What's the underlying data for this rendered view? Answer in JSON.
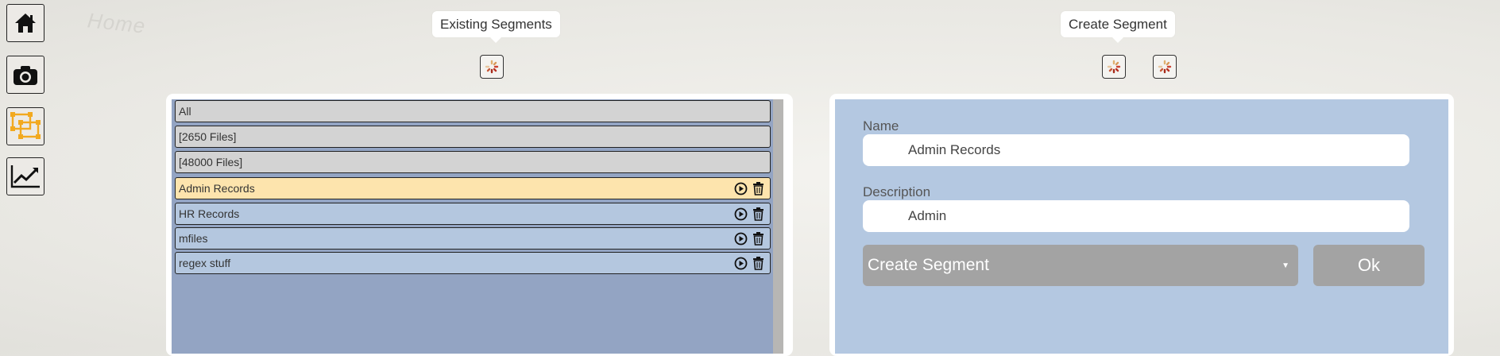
{
  "nav": {
    "ghost_title": "Home",
    "items": [
      {
        "name": "home-icon"
      },
      {
        "name": "camera-icon"
      },
      {
        "name": "segments-icon",
        "accent": "#f2a91f"
      },
      {
        "name": "chart-line-icon"
      }
    ]
  },
  "existing_segments": {
    "tooltip": "Existing Segments",
    "rows": [
      {
        "label": "All",
        "kind": "plain"
      },
      {
        "label": "[2650 Files]",
        "kind": "plain"
      },
      {
        "label": "[48000 Files]",
        "kind": "plain"
      },
      {
        "label": "Admin Records",
        "kind": "selected"
      },
      {
        "label": "HR Records",
        "kind": "item"
      },
      {
        "label": "mfiles",
        "kind": "item"
      },
      {
        "label": "regex stuff",
        "kind": "item"
      }
    ]
  },
  "create_segment": {
    "tooltip": "Create Segment",
    "name_label": "Name",
    "name_value": "Admin Records",
    "description_label": "Description",
    "description_value": "Admin",
    "select_value": "Create Segment",
    "ok_label": "Ok"
  },
  "colors": {
    "list_bg": "#93a4c3",
    "row_plain": "#d3d3d3",
    "row_item": "#b4c7df",
    "row_selected": "#fde4ad",
    "form_bg": "#b4c8e1",
    "button_gray": "#a3a3a3"
  }
}
